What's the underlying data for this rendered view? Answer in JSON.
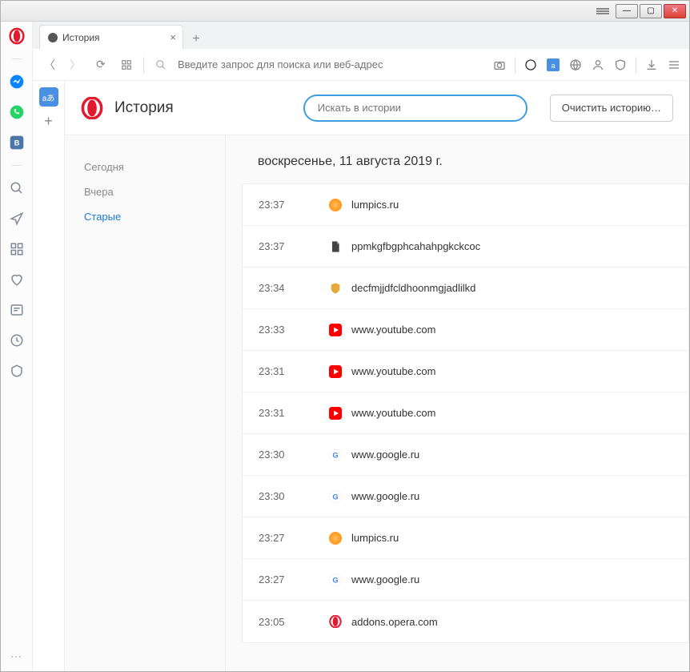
{
  "tab": {
    "title": "История"
  },
  "addressbar": {
    "placeholder": "Введите запрос для поиска или веб-адрес"
  },
  "page": {
    "title": "История",
    "search_placeholder": "Искать в истории",
    "clear_label": "Очистить историю…"
  },
  "nav": {
    "items": [
      {
        "label": "Сегодня",
        "active": false
      },
      {
        "label": "Вчера",
        "active": false
      },
      {
        "label": "Старые",
        "active": true
      }
    ]
  },
  "date_heading": "воскресенье, 11 августа 2019 г.",
  "history": [
    {
      "time": "23:37",
      "site": "lumpics.ru",
      "icon": "orange"
    },
    {
      "time": "23:37",
      "site": "ppmkgfbgphcahahpgkckcoc",
      "icon": "file"
    },
    {
      "time": "23:34",
      "site": "decfmjjdfcldhoonmgjadlilkd",
      "icon": "shield"
    },
    {
      "time": "23:33",
      "site": "www.youtube.com",
      "icon": "yt"
    },
    {
      "time": "23:31",
      "site": "www.youtube.com",
      "icon": "yt"
    },
    {
      "time": "23:31",
      "site": "www.youtube.com",
      "icon": "yt"
    },
    {
      "time": "23:30",
      "site": "www.google.ru",
      "icon": "g"
    },
    {
      "time": "23:30",
      "site": "www.google.ru",
      "icon": "g"
    },
    {
      "time": "23:27",
      "site": "lumpics.ru",
      "icon": "orange"
    },
    {
      "time": "23:27",
      "site": "www.google.ru",
      "icon": "g"
    },
    {
      "time": "23:05",
      "site": "addons.opera.com",
      "icon": "op"
    }
  ]
}
